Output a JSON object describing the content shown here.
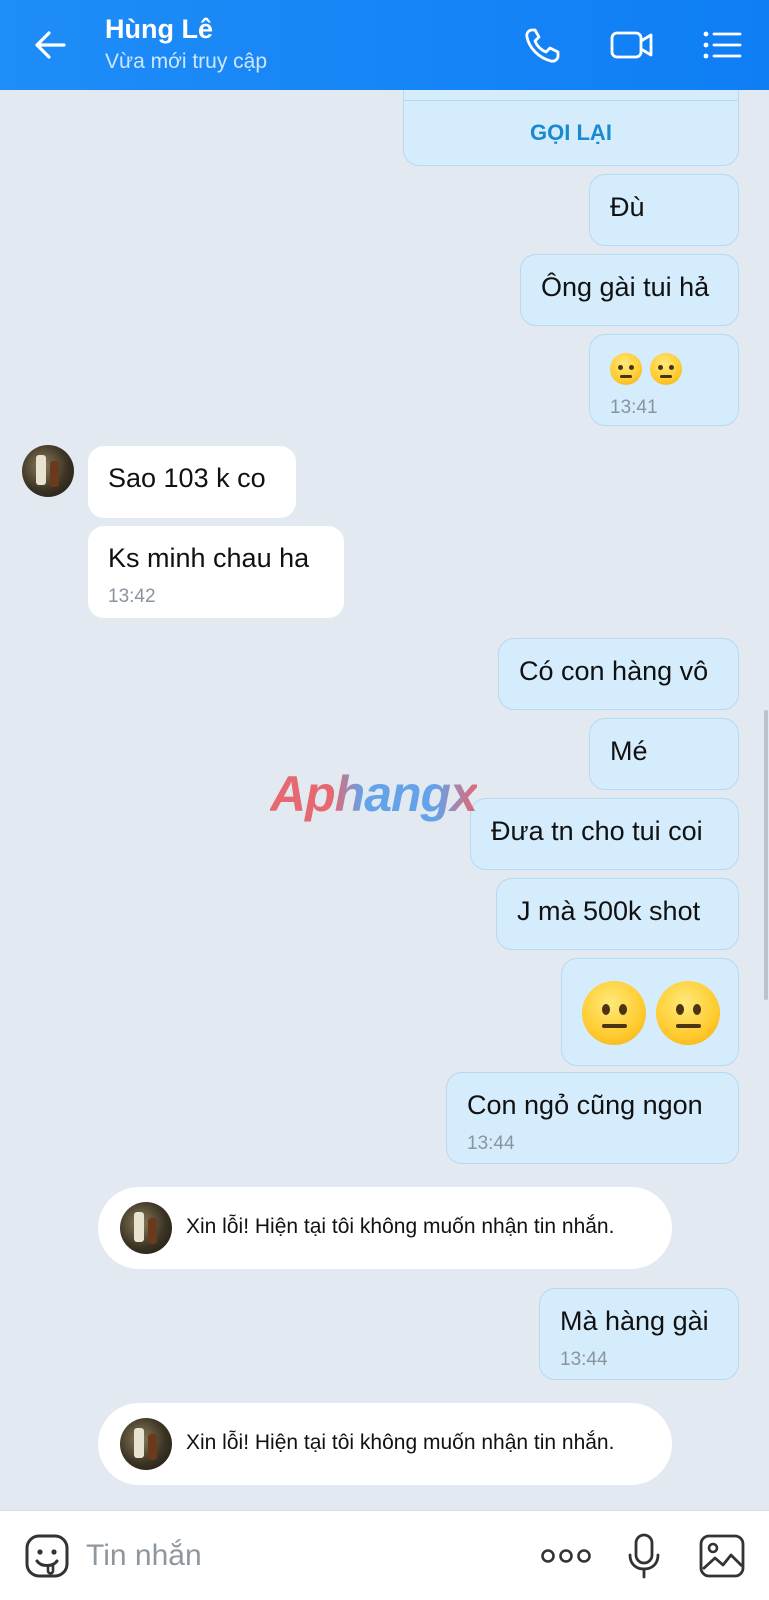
{
  "header": {
    "contact_name": "Hùng Lê",
    "status": "Vừa mới truy cập",
    "icons": [
      "back-arrow-icon",
      "phone-icon",
      "video-call-icon",
      "menu-icon"
    ]
  },
  "messages": {
    "callback_label": "GỌI LẠI",
    "m1": "Đù",
    "m2": "Ông gài tui hả",
    "m3_time": "13:41",
    "m4": "Sao 103 k co",
    "m5": "Ks minh chau ha",
    "m5_time": "13:42",
    "m6": "Có con hàng vô",
    "m7": "Mé",
    "m8": "Đưa tn cho tui coi",
    "m9": "J mà 500k shot",
    "m11": "Con ngỏ cũng ngon",
    "m11_time": "13:44",
    "sys1": "Xin lỗi! Hiện tại tôi không muốn nhận tin nhắn.",
    "m12": "Mà hàng gài",
    "m12_time": "13:44",
    "sys2": "Xin lỗi! Hiện tại tôi không muốn nhận tin nhắn."
  },
  "watermark": "Aphangx",
  "composer": {
    "placeholder": "Tin nhắn",
    "icons": [
      "sticker-icon",
      "more-icon",
      "microphone-icon",
      "gallery-icon"
    ]
  },
  "colors": {
    "header": "#1e8df7",
    "outgoing_bubble": "#d4ecfc",
    "incoming_bubble": "#ffffff",
    "chat_background": "#e2e9f1",
    "callback_text": "#1a8ad0"
  }
}
